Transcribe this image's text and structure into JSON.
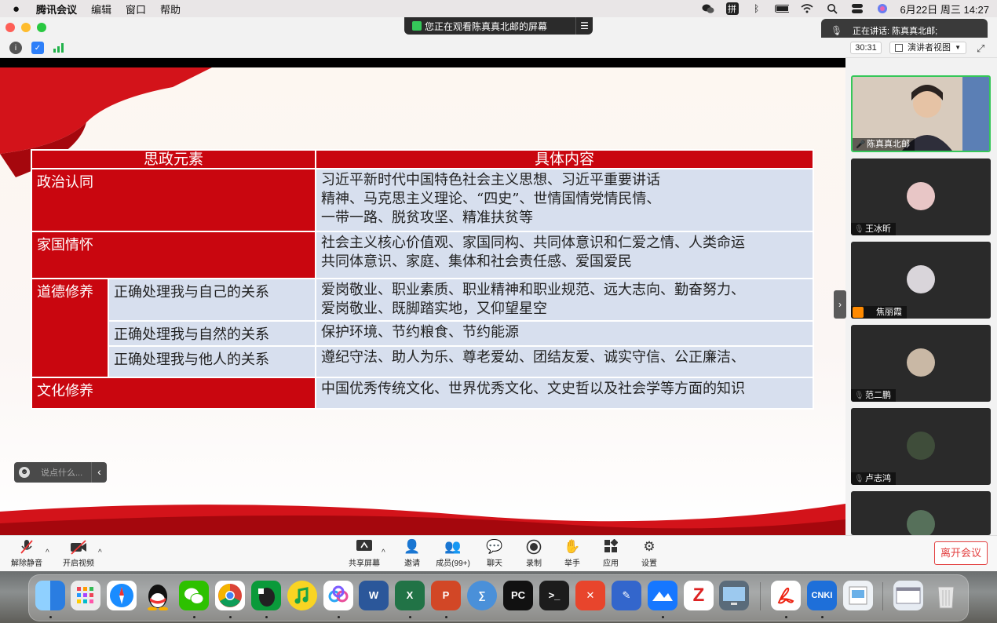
{
  "menubar": {
    "app_name": "腾讯会议",
    "menus": [
      "编辑",
      "窗口",
      "帮助"
    ],
    "status_icons": [
      "wechat-icon",
      "input-method-icon",
      "bluetooth-icon",
      "battery-icon",
      "wifi-icon",
      "spotlight-icon",
      "control-center-icon",
      "siri-icon"
    ],
    "input_method": "拼",
    "datetime": "6月22日 周三 14:27"
  },
  "meeting": {
    "sharing_banner": "您正在观看陈真真北邮的屏幕",
    "speaking_now": "正在讲话: 陈真真北邮;",
    "elapsed": "30:31",
    "view_mode": "演讲者视图"
  },
  "slide": {
    "headers": [
      "思政元素",
      "具体内容"
    ],
    "rows": [
      {
        "category": "政治认同",
        "sub": "",
        "lines": [
          "习近平新时代中国特色社会主义思想、习近平重要讲话",
          "精神、马克思主义理论、“四史”、世情国情党情民情、",
          "一带一路、脱贫攻坚、精准扶贫等"
        ]
      },
      {
        "category": "家国情怀",
        "sub": "",
        "lines": [
          "社会主义核心价值观、家国同构、共同体意识和仁爱之情、人类命运",
          "共同体意识、家庭、集体和社会责任感、爱国爱民"
        ]
      },
      {
        "category": "道德修养",
        "sub": "正确处理我与自己的关系",
        "lines": [
          "爱岗敬业、职业素质、职业精神和职业规范、远大志向、勤奋努力、",
          "爱岗敬业、既脚踏实地，又仰望星空"
        ]
      },
      {
        "category": "",
        "sub": "正确处理我与自然的关系",
        "lines": [
          "保护环境、节约粮食、节约能源"
        ]
      },
      {
        "category": "",
        "sub": "正确处理我与他人的关系",
        "lines": [
          "遵纪守法、助人为乐、尊老爱幼、团结友爱、诚实守信、公正廉洁、"
        ]
      },
      {
        "category": "文化修养",
        "sub": "",
        "lines": [
          "中国优秀传统文化、世界优秀文化、文史哲以及社会学等方面的知识"
        ]
      }
    ]
  },
  "chat": {
    "placeholder": "说点什么..."
  },
  "participants": [
    {
      "name": "陈真真北邮",
      "mic": "on"
    },
    {
      "name": "王冰昕",
      "mic": "off"
    },
    {
      "name": "焦丽霞",
      "mic": "off"
    },
    {
      "name": "范二鹏",
      "mic": "off"
    },
    {
      "name": "卢志鸿",
      "mic": "off"
    }
  ],
  "toolbar": {
    "unmute": "解除静音",
    "start_video": "开启视频",
    "share_screen": "共享屏幕",
    "invite": "邀请",
    "members": "成员(99+)",
    "chat": "聊天",
    "record": "录制",
    "raise_hand": "举手",
    "apps": "应用",
    "settings": "设置",
    "leave": "离开会议"
  },
  "dock": {
    "apps": [
      "finder-icon",
      "launchpad-icon",
      "safari-icon",
      "qq-icon",
      "wechat-icon",
      "chrome-icon",
      "evernote-icon",
      "music-icon",
      "baidu-netdisk-icon",
      "word-icon",
      "excel-icon",
      "powerpoint-icon",
      "mathtype-icon",
      "pycharm-icon",
      "terminal-icon",
      "xmind-icon",
      "pencil-icon",
      "lark-icon",
      "zotero-icon",
      "screen-icon",
      "acrobat-icon",
      "cnki-icon",
      "preview-icon",
      "window-icon",
      "trash-icon"
    ],
    "pycharm_label": "PC",
    "cnki_label": "CNKI"
  },
  "colors": {
    "slide_red": "#c9060f",
    "cell_blue": "#d7dfee",
    "leave_red": "#e34040"
  }
}
